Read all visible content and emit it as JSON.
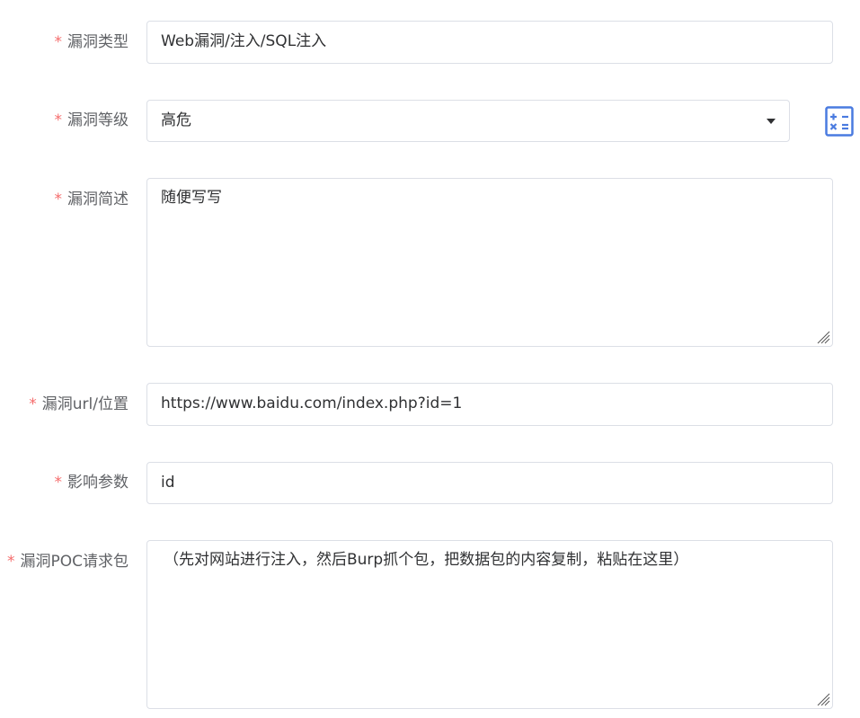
{
  "form": {
    "required_mark": "*",
    "fields": [
      {
        "label": "漏洞类型",
        "value": "Web漏洞/注入/SQL注入"
      },
      {
        "label": "漏洞等级",
        "value": "高危"
      },
      {
        "label": "漏洞简述",
        "value": "随便写写"
      },
      {
        "label": "漏洞url/位置",
        "value": "https://www.baidu.com/index.php?id=1"
      },
      {
        "label": "影响参数",
        "value": "id"
      },
      {
        "label": "漏洞POC请求包",
        "value": "（先对网站进行注入，然后Burp抓个包，把数据包的内容复制，粘贴在这里）"
      }
    ]
  },
  "colors": {
    "required": "#f56c6c",
    "label": "#606266",
    "text": "#303133",
    "border": "#dcdfe6",
    "calc_icon": "#4a7be0"
  },
  "icons": {
    "select_caret": "caret-down-icon",
    "calculator": "calculator-icon",
    "resize": "resize-handle-icon"
  }
}
